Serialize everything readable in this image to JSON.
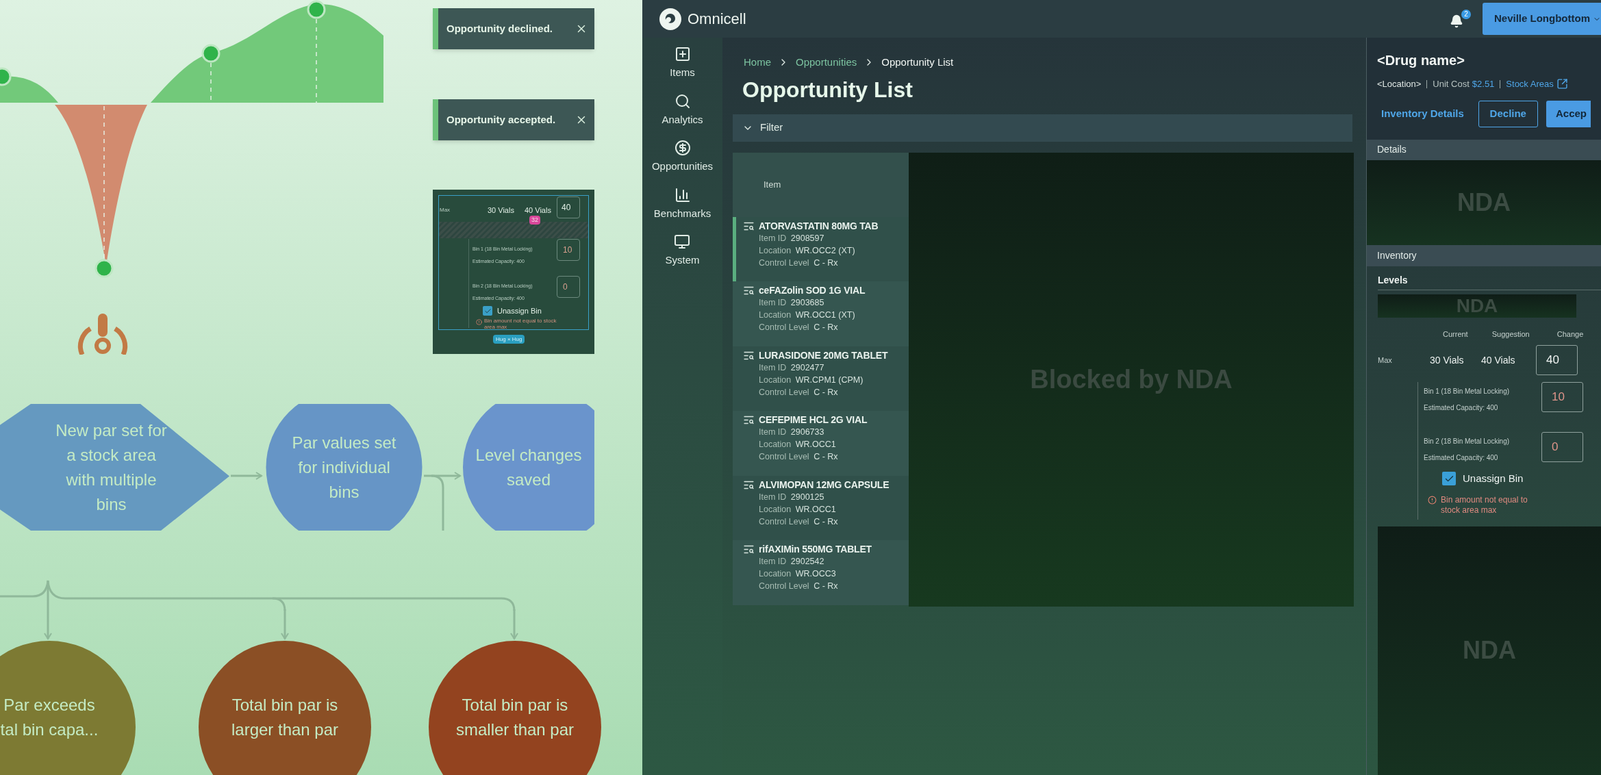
{
  "collage": {
    "toasts": [
      {
        "message": "Opportunity declined."
      },
      {
        "message": "Opportunity accepted."
      }
    ],
    "levels_preview": {
      "max_label": "Max",
      "current": "30 Vials",
      "suggestion": "40 Vials",
      "change": "40",
      "spacing_badge": "32",
      "bins": [
        {
          "label": "Bin 1 (18 Bin Metal Locking)",
          "capacity": "Estimated Capacity: 400",
          "value": "10"
        },
        {
          "label": "Bin 2 (18 Bin Metal Locking)",
          "capacity": "Estimated Capacity: 400",
          "value": "0"
        }
      ],
      "unassign": {
        "label": "Unassign Bin",
        "checked": true
      },
      "error": "Bin amount not equal to stock area max",
      "size_tag": "Hug × Hug"
    },
    "flow": {
      "top_nodes": [
        {
          "kind": "hexagon",
          "color": "#6599c0",
          "lines": [
            "New par set for",
            "a stock area",
            "with multiple",
            "bins"
          ]
        },
        {
          "kind": "circle",
          "color": "#6695c6",
          "lines": [
            "Par values set",
            "for individual",
            "bins"
          ]
        },
        {
          "kind": "circle",
          "color": "#6a94cc",
          "lines": [
            "Level changes",
            "saved"
          ]
        }
      ],
      "bottom_nodes": [
        {
          "kind": "circle",
          "color": "#7d7a33",
          "lines": [
            "Par exceeds",
            "tal bin capa..."
          ]
        },
        {
          "kind": "circle",
          "color": "#8b4f25",
          "lines": [
            "Total bin par is",
            "larger than par"
          ]
        },
        {
          "kind": "circle",
          "color": "#93431f",
          "lines": [
            "Total bin par is",
            "smaller than par"
          ]
        }
      ]
    }
  },
  "app": {
    "top_bar": {
      "logo": "Omnicell",
      "notification_count": "2",
      "user": "Neville Longbottom"
    },
    "sidebar": {
      "items": [
        {
          "label": "Items"
        },
        {
          "label": "Analytics"
        },
        {
          "label": "Opportunities"
        },
        {
          "label": "Benchmarks"
        },
        {
          "label": "System"
        }
      ]
    },
    "breadcrumb": [
      {
        "label": "Home",
        "current": false
      },
      {
        "label": "Opportunities",
        "current": false
      },
      {
        "label": "Opportunity List",
        "current": true
      }
    ],
    "title": "Opportunity List",
    "filter": {
      "label": "Filter"
    },
    "table": {
      "columns": [
        "Item"
      ],
      "blocked_text": "Blocked by NDA",
      "rows": [
        {
          "name": "ATORVASTATIN 80MG TAB",
          "fields": [
            {
              "label": "Item ID",
              "value": "2908597"
            },
            {
              "label": "Location",
              "value": "WR.OCC2 (XT)"
            },
            {
              "label": "Control Level",
              "value": "C - Rx"
            }
          ],
          "selected": true
        },
        {
          "name": "ceFAZolin SOD 1G VIAL",
          "fields": [
            {
              "label": "Item ID",
              "value": "2903685"
            },
            {
              "label": "Location",
              "value": "WR.OCC1 (XT)"
            },
            {
              "label": "Control Level",
              "value": "C - Rx"
            }
          ],
          "selected": false
        },
        {
          "name": "LURASIDONE 20MG TABLET",
          "fields": [
            {
              "label": "Item ID",
              "value": "2902477"
            },
            {
              "label": "Location",
              "value": "WR.CPM1 (CPM)"
            },
            {
              "label": "Control Level",
              "value": "C - Rx"
            }
          ],
          "selected": false
        },
        {
          "name": "CEFEPIME HCL 2G VIAL",
          "fields": [
            {
              "label": "Item ID",
              "value": "2906733"
            },
            {
              "label": "Location",
              "value": "WR.OCC1"
            },
            {
              "label": "Control Level",
              "value": "C - Rx"
            }
          ],
          "selected": false
        },
        {
          "name": "ALVIMOPAN 12MG CAPSULE",
          "fields": [
            {
              "label": "Item ID",
              "value": "2900125"
            },
            {
              "label": "Location",
              "value": "WR.OCC1"
            },
            {
              "label": "Control Level",
              "value": "C - Rx"
            }
          ],
          "selected": false
        },
        {
          "name": "rifAXIMin 550MG TABLET",
          "fields": [
            {
              "label": "Item ID",
              "value": "2902542"
            },
            {
              "label": "Location",
              "value": "WR.OCC3"
            },
            {
              "label": "Control Level",
              "value": "C - Rx"
            }
          ],
          "selected": false
        }
      ]
    },
    "detail_panel": {
      "drug_name": "<Drug name>",
      "location": "<Location>",
      "unit_cost_label": "Unit Cost",
      "unit_cost": "$2.51",
      "stock_areas": "Stock Areas",
      "buttons": {
        "details": "Inventory Details",
        "decline": "Decline",
        "accept": "Accep"
      },
      "details_header": "Details",
      "details_blocked": "NDA",
      "inventory_header": "Inventory",
      "levels_label": "Levels",
      "levels_blocked": "NDA",
      "columns": [
        "Current",
        "Suggestion",
        "Change"
      ],
      "levels": {
        "max_label": "Max",
        "current": "30 Vials",
        "suggestion": "40 Vials",
        "change": "40",
        "bins": [
          {
            "label": "Bin 1 (18 Bin Metal Locking)",
            "capacity": "Estimated Capacity: 400",
            "value": "10"
          },
          {
            "label": "Bin 2 (18 Bin Metal Locking)",
            "capacity": "Estimated Capacity: 400",
            "value": "0"
          }
        ],
        "unassign": {
          "label": "Unassign Bin",
          "checked": true
        },
        "error": "Bin amount not equal to stock area max"
      },
      "lower_blocked": "NDA"
    }
  }
}
